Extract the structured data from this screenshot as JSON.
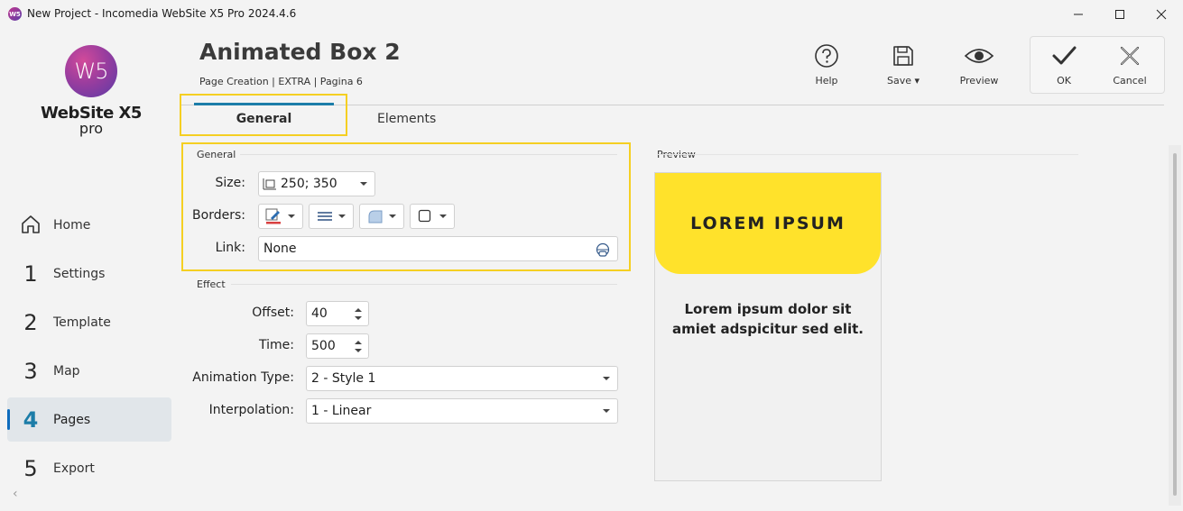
{
  "window": {
    "title": "New Project - Incomedia WebSite X5 Pro 2024.4.6",
    "app_icon": "W5"
  },
  "sidebar": {
    "logo": {
      "mark": "W5",
      "name": "WebSite X5",
      "edition": "pro"
    },
    "items": [
      {
        "num": "",
        "icon": "home-icon",
        "label": "Home"
      },
      {
        "num": "1",
        "label": "Settings"
      },
      {
        "num": "2",
        "label": "Template"
      },
      {
        "num": "3",
        "label": "Map"
      },
      {
        "num": "4",
        "label": "Pages",
        "active": true
      },
      {
        "num": "5",
        "label": "Export"
      }
    ]
  },
  "header": {
    "title": "Animated Box 2",
    "breadcrumb": "Page Creation | EXTRA | Pagina 6"
  },
  "toolbar": {
    "help_label": "Help",
    "save_label": "Save",
    "preview_label": "Preview",
    "ok_label": "OK",
    "cancel_label": "Cancel"
  },
  "tabs": [
    {
      "label": "General",
      "active": true
    },
    {
      "label": "Elements"
    }
  ],
  "general_group": {
    "title": "General",
    "size_label": "Size:",
    "size_value": "250; 350",
    "borders_label": "Borders:",
    "link_label": "Link:",
    "link_value": "None"
  },
  "effect_group": {
    "title": "Effect",
    "offset_label": "Offset:",
    "offset_value": "40",
    "time_label": "Time:",
    "time_value": "500",
    "animation_label": "Animation Type:",
    "animation_value": "2 - Style 1",
    "interpolation_label": "Interpolation:",
    "interpolation_value": "1 - Linear"
  },
  "preview": {
    "title": "Preview",
    "heading": "LOREM IPSUM",
    "body_line1": "Lorem ipsum dolor sit",
    "body_line2": "amiet adspicitur sed elit."
  },
  "colors": {
    "accent": "#1c7da8",
    "highlight": "#f5cf22",
    "preview_box": "#ffe22b"
  }
}
